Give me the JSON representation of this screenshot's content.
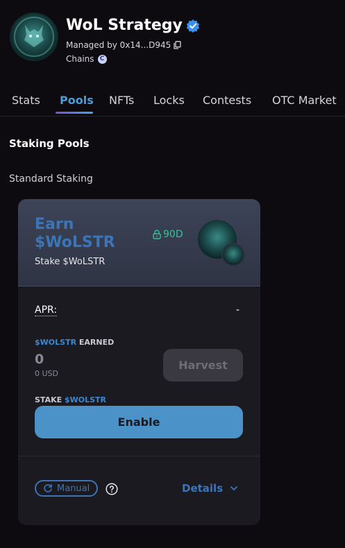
{
  "header": {
    "title": "WoL Strategy",
    "managed_by": "Managed by 0x14...D945",
    "chains_label": "Chains",
    "chain_badge": "C"
  },
  "tabs": [
    {
      "label": "Stats"
    },
    {
      "label": "Pools"
    },
    {
      "label": "NFTs"
    },
    {
      "label": "Locks"
    },
    {
      "label": "Contests"
    },
    {
      "label": "OTC Market"
    }
  ],
  "active_tab": "Pools",
  "section_title": "Staking Pools",
  "subsection_title": "Standard Staking",
  "pool": {
    "earn_title_line1": "Earn",
    "earn_title_line2": "$WoLSTR",
    "stake_subtitle": "Stake $WoLSTR",
    "lock_duration": "90D",
    "apr_label": "APR:",
    "apr_value": "-",
    "earned_token": "$WOLSTR",
    "earned_suffix": " EARNED",
    "earned_amount": "0",
    "earned_usd": "0 USD",
    "harvest_label": "Harvest",
    "stake_prefix": "STAKE ",
    "stake_token": "$WOLSTR",
    "enable_label": "Enable",
    "manual_label": "Manual",
    "details_label": "Details"
  },
  "colors": {
    "accent": "#3b75b8",
    "lock_green": "#35c39a",
    "enable_button": "#4a92c8"
  }
}
